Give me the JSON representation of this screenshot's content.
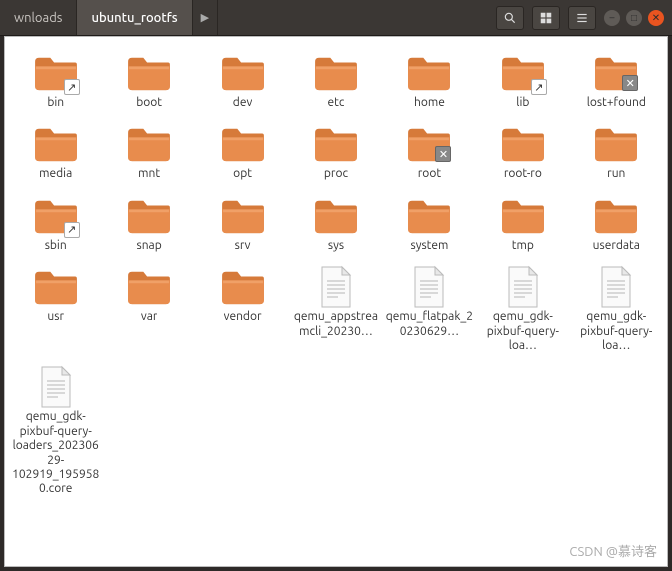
{
  "breadcrumb": {
    "prev": "wnloads",
    "current": "ubuntu_rootfs"
  },
  "items": [
    {
      "type": "folder",
      "emblem": "link",
      "label": "bin"
    },
    {
      "type": "folder",
      "emblem": null,
      "label": "boot"
    },
    {
      "type": "folder",
      "emblem": null,
      "label": "dev"
    },
    {
      "type": "folder",
      "emblem": null,
      "label": "etc"
    },
    {
      "type": "folder",
      "emblem": null,
      "label": "home"
    },
    {
      "type": "folder",
      "emblem": "link",
      "label": "lib"
    },
    {
      "type": "folder",
      "emblem": "lock",
      "label": "lost+found"
    },
    {
      "type": "folder",
      "emblem": null,
      "label": "media"
    },
    {
      "type": "folder",
      "emblem": null,
      "label": "mnt"
    },
    {
      "type": "folder",
      "emblem": null,
      "label": "opt"
    },
    {
      "type": "folder",
      "emblem": null,
      "label": "proc"
    },
    {
      "type": "folder",
      "emblem": "lock",
      "label": "root"
    },
    {
      "type": "folder",
      "emblem": null,
      "label": "root-ro"
    },
    {
      "type": "folder",
      "emblem": null,
      "label": "run"
    },
    {
      "type": "folder",
      "emblem": "link",
      "label": "sbin"
    },
    {
      "type": "folder",
      "emblem": null,
      "label": "snap"
    },
    {
      "type": "folder",
      "emblem": null,
      "label": "srv"
    },
    {
      "type": "folder",
      "emblem": null,
      "label": "sys"
    },
    {
      "type": "folder",
      "emblem": null,
      "label": "system"
    },
    {
      "type": "folder",
      "emblem": null,
      "label": "tmp"
    },
    {
      "type": "folder",
      "emblem": null,
      "label": "userdata"
    },
    {
      "type": "folder",
      "emblem": null,
      "label": "usr"
    },
    {
      "type": "folder",
      "emblem": null,
      "label": "var"
    },
    {
      "type": "folder",
      "emblem": null,
      "label": "vendor"
    },
    {
      "type": "file",
      "emblem": null,
      "label": "qemu_appstreamcli_20230…"
    },
    {
      "type": "file",
      "emblem": null,
      "label": "qemu_flatpak_20230629…"
    },
    {
      "type": "file",
      "emblem": null,
      "label": "qemu_gdk-pixbuf-query-loa…"
    },
    {
      "type": "file",
      "emblem": null,
      "label": "qemu_gdk-pixbuf-query-loa…"
    },
    {
      "type": "file",
      "emblem": null,
      "label": "qemu_gdk-pixbuf-query-loaders_20230629-102919_1959580.core"
    }
  ],
  "watermark": "CSDN @慕诗客"
}
